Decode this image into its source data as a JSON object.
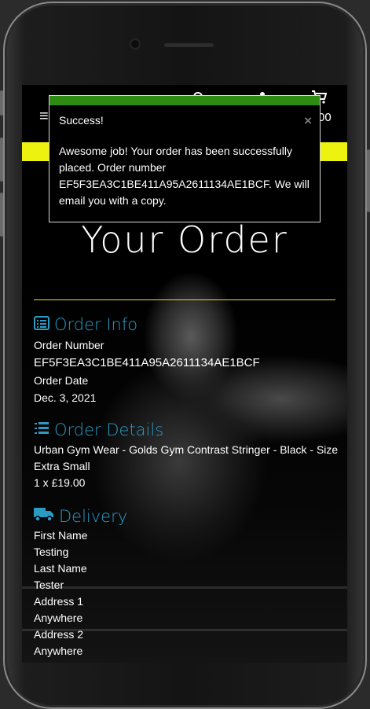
{
  "toast": {
    "title": "Success!",
    "message": "Awesome job! Your order has been successfully placed. Order number EF5F3EA3C1BE411A95A2611134AE1BCF. We will email you with a copy.",
    "close_icon": "×",
    "accent": "#2e8b11"
  },
  "header": {
    "menu_icon": "≡",
    "cart_total": "00"
  },
  "banner_color": "#eef20f",
  "page": {
    "title": "Your Order"
  },
  "order_info": {
    "heading": "Order Info",
    "order_number_label": "Order Number",
    "order_number": "EF5F3EA3C1BE411A95A2611134AE1BCF",
    "order_date_label": "Order Date",
    "order_date": "Dec. 3, 2021"
  },
  "order_details": {
    "heading": "Order Details",
    "item_line1": "Urban Gym Wear - Golds Gym Contrast Stringer - Black - Size",
    "item_line2": "Extra Small",
    "item_price": "1 x £19.00"
  },
  "delivery": {
    "heading": "Delivery",
    "first_name_label": "First Name",
    "first_name": "Testing",
    "last_name_label": "Last Name",
    "last_name": "Tester",
    "address1_label": "Address 1",
    "address1": "Anywhere",
    "address2_label": "Address 2",
    "address2": "Anywhere"
  },
  "heading_color": "#2b9bc4"
}
